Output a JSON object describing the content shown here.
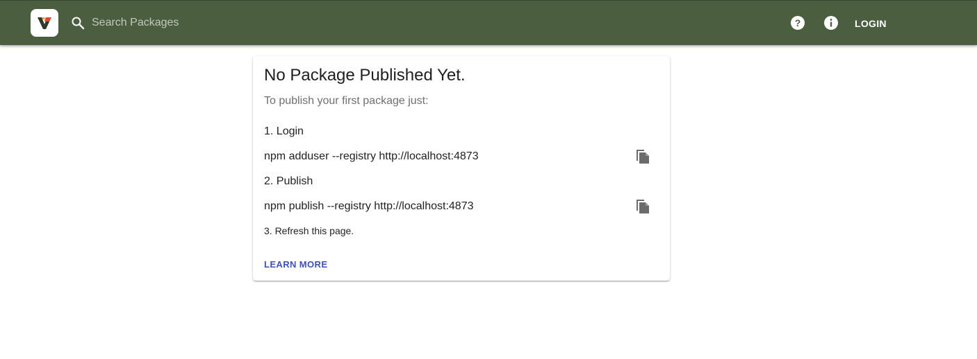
{
  "header": {
    "logo_icon": "verdaccio-logo-icon",
    "search": {
      "icon": "search-icon",
      "placeholder": "Search Packages",
      "value": ""
    },
    "help_icon": "help-icon",
    "info_icon": "info-icon",
    "login_label": "LOGIN",
    "colors": {
      "bar": "#4b5e40",
      "text": "#ffffff"
    }
  },
  "card": {
    "title": "No Package Published Yet.",
    "subtitle": "To publish your first package just:",
    "steps": [
      {
        "label": "1. Login",
        "command": "npm adduser --registry http://localhost:4873",
        "copy_icon": "copy-icon"
      },
      {
        "label": "2. Publish",
        "command": "npm publish --registry http://localhost:4873",
        "copy_icon": "copy-icon"
      }
    ],
    "refresh_text": "3. Refresh this page.",
    "learn_more_label": "LEARN MORE",
    "colors": {
      "link": "#3f51b5"
    }
  }
}
